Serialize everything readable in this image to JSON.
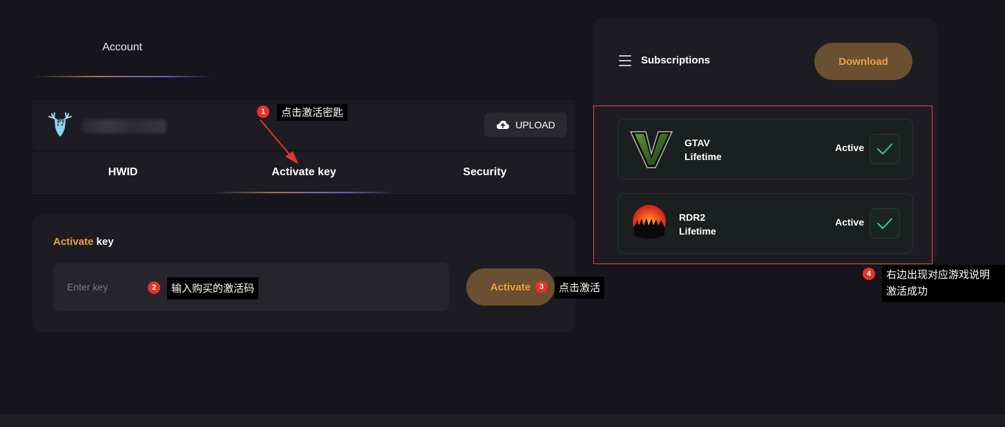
{
  "account_tab": {
    "label": "Account"
  },
  "profile": {
    "upload_label": "UPLOAD"
  },
  "tabs": [
    {
      "label": "HWID"
    },
    {
      "label": "Activate key",
      "active": true
    },
    {
      "label": "Security"
    }
  ],
  "activate": {
    "title_highlight": "Activate",
    "title_rest": " key",
    "input_placeholder": "Enter key",
    "input_value": "",
    "button_label": "Activate"
  },
  "subscriptions": {
    "title": "Subscriptions",
    "download_label": "Download",
    "items": [
      {
        "name": "GTAV",
        "plan": "Lifetime",
        "status": "Active",
        "icon": "gta-v-logo"
      },
      {
        "name": "RDR2",
        "plan": "Lifetime",
        "status": "Active",
        "icon": "rdr2-logo"
      }
    ]
  },
  "annotations": [
    {
      "num": "1",
      "text": "点击激活密匙"
    },
    {
      "num": "2",
      "text": "输入购买的激活码"
    },
    {
      "num": "3",
      "text": "点击激活"
    },
    {
      "num": "4",
      "line1": "右边出现对应游戏说明",
      "line2": "激活成功"
    }
  ],
  "colors": {
    "background": "#16151b",
    "panel": "#1d1c22",
    "accent": "#e8a23e",
    "accent_button": "#6a4f30",
    "check": "#2fd38a",
    "annotation_red": "#e4342c"
  }
}
